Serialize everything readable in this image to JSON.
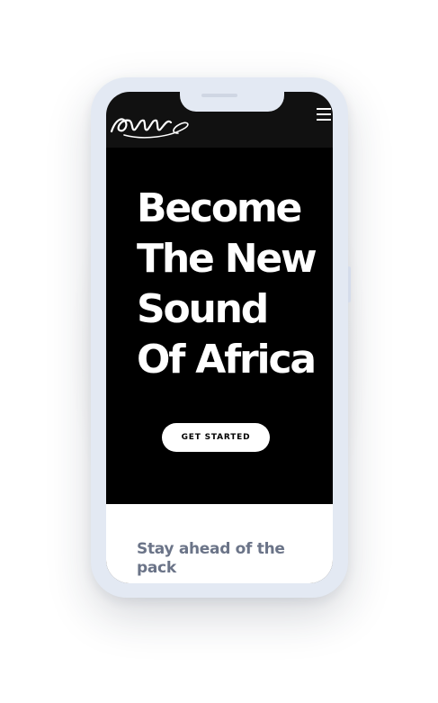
{
  "header": {
    "logo_icon": "script-signature-logo",
    "menu_icon": "hamburger-menu-icon"
  },
  "hero": {
    "title_lines": [
      "Become",
      "The New",
      "Sound",
      "Of Africa"
    ],
    "cta_label": "GET STARTED"
  },
  "section": {
    "title": "Stay ahead of the pack"
  },
  "colors": {
    "hero_background": "#000000",
    "frame": "#e3e9f3",
    "section_title": "#6b7488",
    "cta_background": "#ffffff"
  }
}
